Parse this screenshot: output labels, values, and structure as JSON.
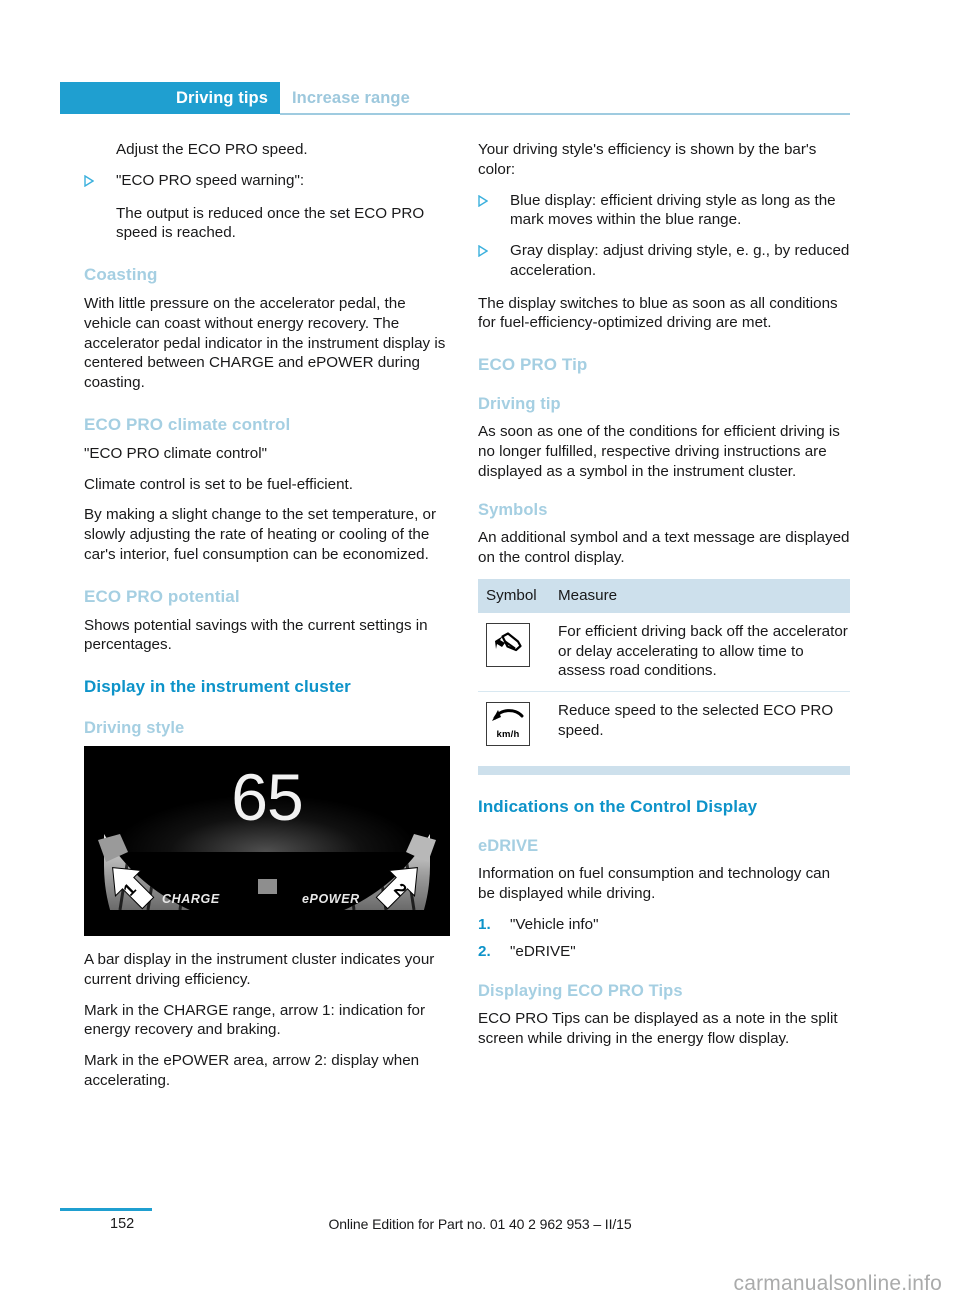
{
  "header": {
    "active_tab": "Driving tips",
    "inactive_tab": "Increase range",
    "accent_color": "#1f9fd0",
    "muted_color": "#9dc8dd"
  },
  "left_column": {
    "continuation_line": "Adjust the ECO PRO speed.",
    "bullet_1": "\"ECO PRO speed warning\":",
    "bullet_1_detail": "The output is reduced once the set ECO PRO speed is reached.",
    "heading_coasting": "Coasting",
    "coasting_body": "With little pressure on the accelerator pedal, the vehicle can coast without energy recovery. The accelerator pedal indicator in the instrument display is centered between CHARGE and ePOWER during coasting.",
    "heading_climate": "ECO PRO climate control",
    "climate_quote": "\"ECO PRO climate control\"",
    "climate_line2": "Climate control is set to be fuel-efficient.",
    "climate_body": "By making a slight change to the set temperature, or slowly adjusting the rate of heating or cooling of the car's interior, fuel consumption can be economized.",
    "heading_potential": "ECO PRO potential",
    "potential_body": "Shows potential savings with the current settings in percentages.",
    "heading_display_cluster": "Display in the instrument cluster",
    "heading_driving_style": "Driving style",
    "figure": {
      "speed_value": "65",
      "label_charge": "CHARGE",
      "label_epower": "ePOWER",
      "arrow_1": "1",
      "arrow_2": "2"
    },
    "figure_caption_1": "A bar display in the instrument cluster indicates your current driving efficiency.",
    "figure_caption_2": "Mark in the CHARGE range, arrow 1: indication for energy recovery and braking.",
    "figure_caption_3": "Mark in the ePOWER area, arrow 2: display when accelerating."
  },
  "right_column": {
    "intro": "Your driving style's efficiency is shown by the bar's color:",
    "bullet_blue": "Blue display: efficient driving style as long as the mark moves within the blue range.",
    "bullet_gray": "Gray display: adjust driving style, e. g., by reduced acceleration.",
    "after_bullets": "The display switches to blue as soon as all conditions for fuel-efficiency-optimized driving are met.",
    "heading_eco_pro_tip": "ECO PRO Tip",
    "heading_driving_tip": "Driving tip",
    "driving_tip_body": "As soon as one of the conditions for efficient driving is no longer fulfilled, respective driving instructions are displayed as a symbol in the instrument cluster.",
    "heading_symbols": "Symbols",
    "symbols_intro": "An additional symbol and a text message are displayed on the control display.",
    "table": {
      "headers": [
        "Symbol",
        "Measure"
      ],
      "header_bg": "#cde0ec",
      "rows": [
        {
          "symbol_name": "foot-off-accelerator-icon",
          "symbol_caption": "",
          "measure": "For efficient driving back off the accelerator or delay accelerating to allow time to assess road conditions."
        },
        {
          "symbol_name": "reduce-speed-kmh-icon",
          "symbol_caption": "km/h",
          "measure": "Reduce speed to the selected ECO PRO speed."
        }
      ]
    },
    "heading_indications": "Indications on the Control Display",
    "heading_edrive": "eDRIVE",
    "edrive_body": "Information on fuel consumption and technology can be displayed while driving.",
    "edrive_steps": [
      "\"Vehicle info\"",
      "\"eDRIVE\""
    ],
    "heading_displaying_tips": "Displaying ECO PRO Tips",
    "displaying_tips_body": "ECO PRO Tips can be displayed as a note in the split screen while driving in the energy flow display."
  },
  "footer": {
    "page_number": "152",
    "edition_text": "Online Edition for Part no. 01 40 2 962 953 – II/15",
    "watermark": "carmanualsonline.info"
  }
}
